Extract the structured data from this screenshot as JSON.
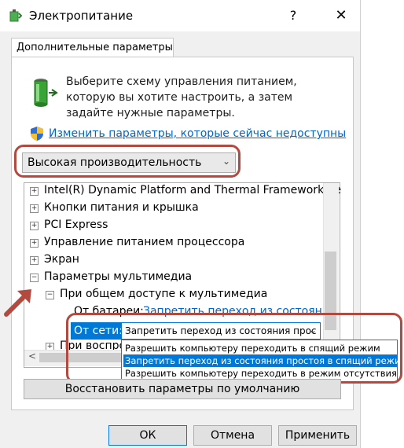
{
  "window": {
    "title": "Электропитание",
    "help_label": "?",
    "close_label": "✕"
  },
  "tab": {
    "label": "Дополнительные параметры"
  },
  "intro_text": "Выберите схему управления питанием, которую вы хотите настроить, а затем задайте нужные параметры.",
  "change_link": "Изменить параметры, которые сейчас недоступны",
  "plan_select": {
    "value": "Высокая производительность"
  },
  "tree": {
    "items": [
      {
        "label": "Intel(R) Dynamic Platform and Thermal Framework Se",
        "expander": "+"
      },
      {
        "label": "Кнопки питания и крышка",
        "expander": "+"
      },
      {
        "label": "PCI Express",
        "expander": "+"
      },
      {
        "label": "Управление питанием процессора",
        "expander": "+"
      },
      {
        "label": "Экран",
        "expander": "+"
      },
      {
        "label": "Параметры мультимедиа",
        "expander": "−"
      }
    ],
    "sub_item": {
      "label": "При общем доступе к мультимедиа",
      "expander": "−"
    },
    "battery_label": "От батареи:",
    "battery_value": "Запретить переход из состояния",
    "truncated_item": {
      "label": "При воспроизведении видео",
      "expander": "+"
    },
    "ac_label": "От сети:",
    "ac_value": "Запретить переход из состояния прос"
  },
  "dropdown_options": [
    {
      "label": "Разрешить компьютеру переходить в спящий режим",
      "selected": false
    },
    {
      "label": "Запретить переход из состояния простоя в спящий режим",
      "selected": true
    },
    {
      "label": "Разрешить компьютеру переходить в режим отсутствия",
      "selected": false
    }
  ],
  "buttons": {
    "restore": "Восстановить параметры по умолчанию",
    "ok": "ОК",
    "cancel": "Отмена",
    "apply": "Применить"
  },
  "colors": {
    "accent": "#0078d7",
    "annotation": "#b34a3f",
    "link": "#0066cc"
  }
}
